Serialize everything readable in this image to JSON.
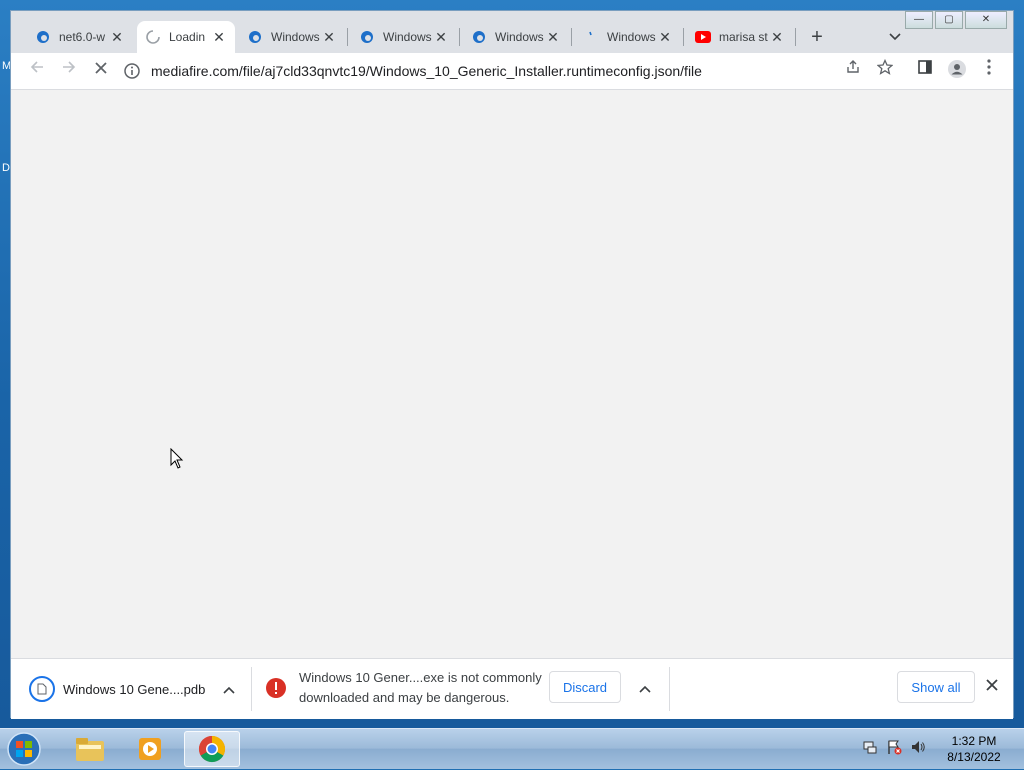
{
  "desktop": {
    "edge_glyph": "D"
  },
  "window_controls": {
    "minimize": "—",
    "maximize": "▢",
    "close": "✕"
  },
  "tabs": [
    {
      "title": "net6.0-w",
      "icon": "edge-favicon",
      "active": false
    },
    {
      "title": "Loadin",
      "icon": "loading-spinner",
      "active": true
    },
    {
      "title": "Windows",
      "icon": "edge-favicon",
      "active": false
    },
    {
      "title": "Windows",
      "icon": "edge-favicon",
      "active": false
    },
    {
      "title": "Windows",
      "icon": "edge-favicon",
      "active": false
    },
    {
      "title": "Windows",
      "icon": "loading-spinner",
      "active": false
    },
    {
      "title": "marisa st",
      "icon": "youtube-favicon",
      "active": false
    }
  ],
  "toolbar": {
    "url": "mediafire.com/file/aj7cld33qnvtc19/Windows_10_Generic_Installer.runtimeconfig.json/file"
  },
  "downloads": {
    "item1_name": "Windows 10 Gene....pdb",
    "item2_warning_line1": "Windows 10 Gener....exe is not commonly",
    "item2_warning_line2": "downloaded and may be dangerous.",
    "discard_label": "Discard",
    "show_all_label": "Show all"
  },
  "taskbar": {
    "time": "1:32 PM",
    "date": "8/13/2022"
  },
  "colors": {
    "accent": "#1a73e8",
    "danger": "#d93025",
    "edge_blue": "#1e6fc9",
    "youtube_red": "#ff0000"
  }
}
